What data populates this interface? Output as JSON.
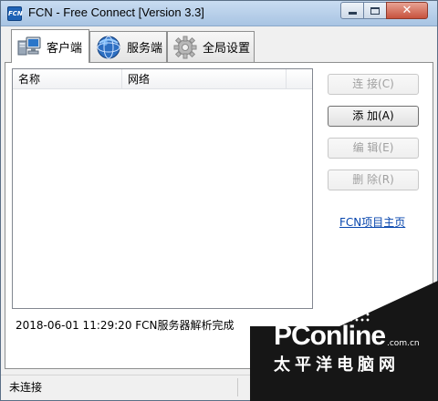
{
  "window": {
    "title": "FCN - Free Connect [Version 3.3]",
    "icon_text": "FCN"
  },
  "tabs": [
    {
      "label": "客户端",
      "icon": "computer-icon",
      "active": true
    },
    {
      "label": "服务端",
      "icon": "globe-icon",
      "active": false
    },
    {
      "label": "全局设置",
      "icon": "gear-icon",
      "active": false
    }
  ],
  "list": {
    "columns": [
      "名称",
      "网络"
    ]
  },
  "buttons": {
    "connect": "连 接(C)",
    "add": "添 加(A)",
    "edit": "编 辑(E)",
    "delete": "删 除(R)"
  },
  "links": {
    "homepage": "FCN项目主页"
  },
  "log": {
    "message": "2018-06-01 11:29:20 FCN服务器解析完成"
  },
  "status": {
    "text": "未连接"
  },
  "watermark": {
    "brand": "PConline",
    "domain": ".com.cn",
    "chinese": "太平洋电脑网"
  }
}
